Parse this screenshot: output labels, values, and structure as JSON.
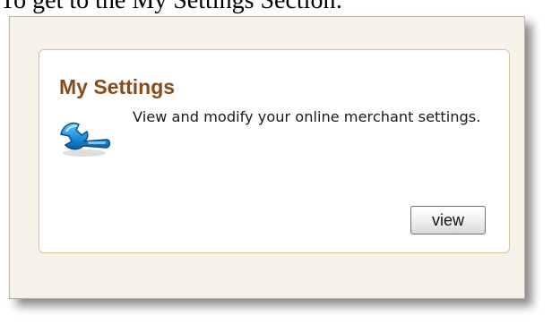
{
  "page": {
    "caption_partial": "To get to the My Settings Section:"
  },
  "card": {
    "title": "My Settings",
    "description": "View and modify your online merchant settings.",
    "icon": "wrench-icon",
    "view_label": "view"
  },
  "colors": {
    "title": "#8a4b1c",
    "panel_background": "#f6f2e7",
    "card_border": "#cfc79a",
    "icon_blue": "#1f8fd8"
  }
}
